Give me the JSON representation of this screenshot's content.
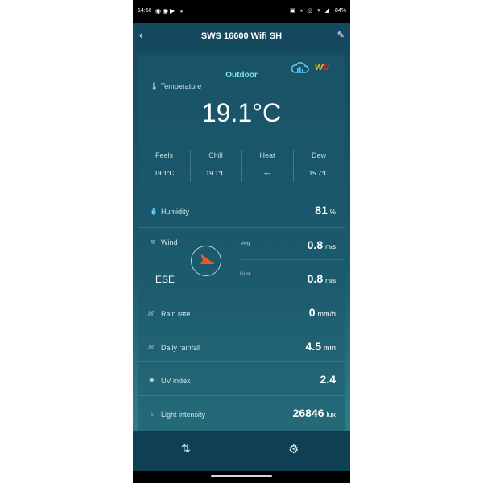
{
  "status_bar": {
    "time": "14:56",
    "battery": "84%"
  },
  "header": {
    "title": "SWS 16600 Wifi SH"
  },
  "outdoor": {
    "title": "Outdoor",
    "temperature": {
      "label": "Temperature",
      "value": "19.1°C",
      "details": [
        {
          "label": "Feels",
          "value": "19.1°C"
        },
        {
          "label": "Chill",
          "value": "19.1°C"
        },
        {
          "label": "Heat",
          "value": "---"
        },
        {
          "label": "Dew",
          "value": "15.7°C"
        }
      ]
    },
    "humidity": {
      "label": "Humidity",
      "value": "81",
      "unit": "%"
    },
    "wind": {
      "label": "Wind",
      "direction": "ESE",
      "avg_label": "Avg",
      "avg_value": "0.8",
      "avg_unit": "m/s",
      "gust_label": "Gust",
      "gust_value": "0.8",
      "gust_unit": "m/s"
    },
    "rain_rate": {
      "label": "Rain rate",
      "value": "0",
      "unit": "mm/h"
    },
    "daily_rainfall": {
      "label": "Daily rainfall",
      "value": "4.5",
      "unit": "mm"
    },
    "uv_index": {
      "label": "UV index",
      "value": "2.4"
    },
    "light_intensity": {
      "label": "Light intensity",
      "value": "26846",
      "unit": "lux"
    }
  },
  "icons": {
    "back": "chevron-left-icon",
    "edit": "pencil-icon",
    "cloud": "weathercloud-icon",
    "wu": "wunderground-logo",
    "sort": "sort-arrows-icon",
    "settings": "gear-icon"
  },
  "colors": {
    "background": "#1a5a6d",
    "accent": "#7fe6f6",
    "compass_arrow": "#f0542a"
  }
}
